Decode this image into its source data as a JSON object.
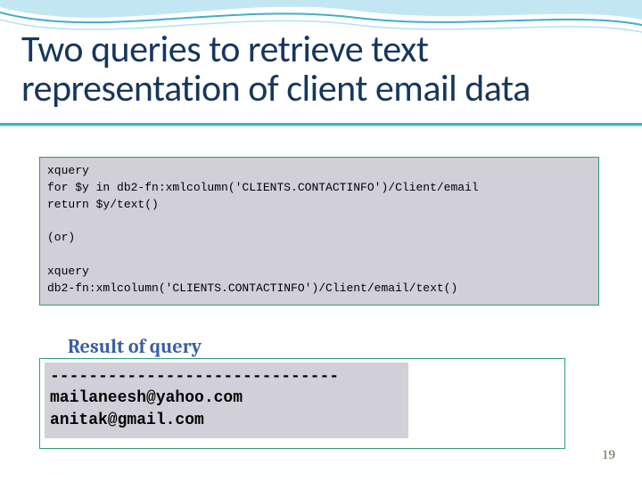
{
  "title": "Two queries to retrieve text representation of client email data",
  "code_block": "xquery\nfor $y in db2-fn:xmlcolumn('CLIENTS.CONTACTINFO')/Client/email\nreturn $y/text()\n\n(or)\n\nxquery\ndb2-fn:xmlcolumn('CLIENTS.CONTACTINFO')/Client/email/text()",
  "result_label": "Result of query",
  "result_divider": "------------------------------",
  "result_rows": [
    "mailaneesh@yahoo.com",
    "anitak@gmail.com"
  ],
  "page_number": "19"
}
